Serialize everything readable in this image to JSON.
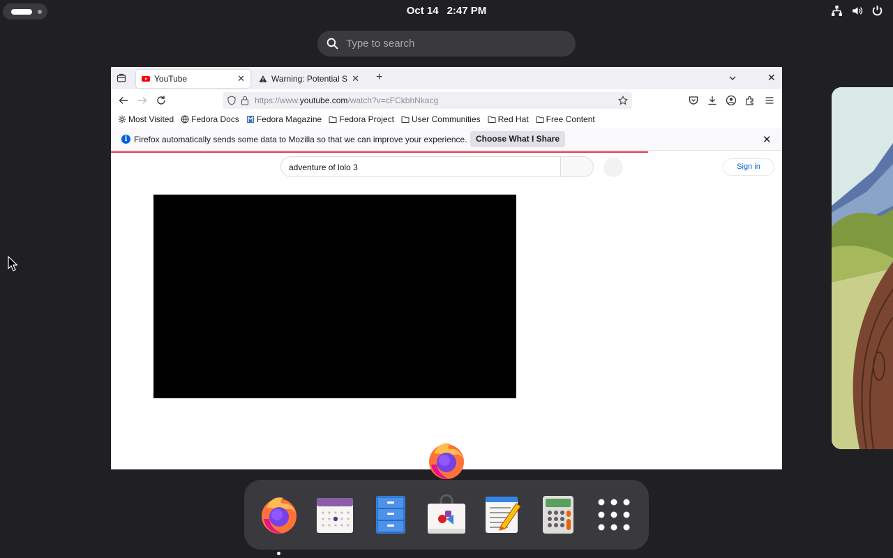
{
  "topbar": {
    "date": "Oct 14",
    "time": "2:47 PM",
    "icons": [
      "network-icon",
      "volume-icon",
      "power-icon"
    ]
  },
  "search": {
    "placeholder": "Type to search"
  },
  "browser": {
    "tabs": [
      {
        "title": "YouTube",
        "active": true
      },
      {
        "title": "Warning: Potential Secu",
        "active": false
      }
    ],
    "url_prefix": "https://www.",
    "url_domain": "youtube.com",
    "url_path": "/watch?v=cFCkbhNkacg",
    "bookmarks": [
      "Most Visited",
      "Fedora Docs",
      "Fedora Magazine",
      "Fedora Project",
      "User Communities",
      "Red Hat",
      "Free Content"
    ],
    "notification": {
      "message": "Firefox automatically sends some data to Mozilla so that we can improve your experience.",
      "button": "Choose What I Share"
    },
    "page": {
      "search_query": "adventure of lolo 3",
      "sign_in": "Sign in"
    }
  },
  "dock": {
    "apps": [
      "Firefox",
      "Calendar",
      "Files",
      "Software",
      "Text Editor",
      "Calculator",
      "Show Apps"
    ],
    "running": "Firefox"
  },
  "colors": {
    "background": "#202024",
    "panel": "#3a3a3e",
    "accent_blue": "#0060df",
    "progress_red": "#e8354a"
  }
}
